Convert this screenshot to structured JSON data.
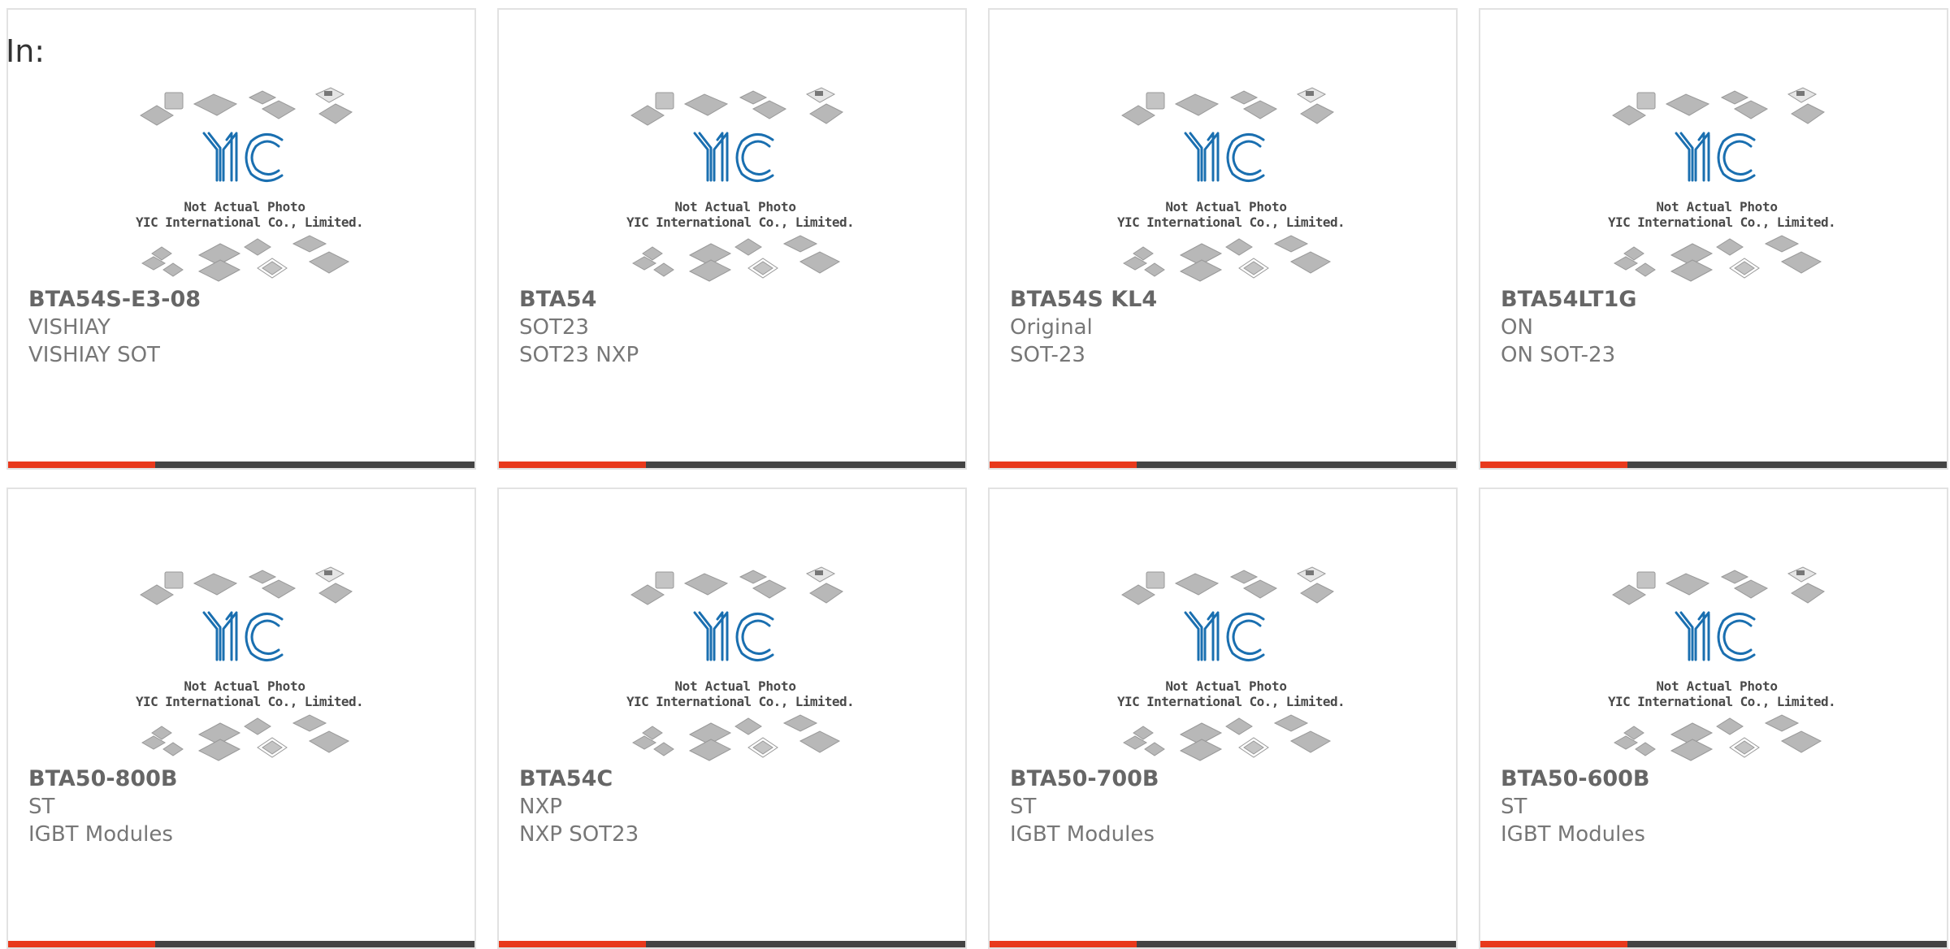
{
  "header": {
    "label": "In:"
  },
  "placeholder": {
    "logo_text": "YIC",
    "line1": "Not Actual Photo",
    "line2": "YIC International Co., Limited."
  },
  "colors": {
    "accent": "#e8391c",
    "bar": "#444444",
    "logo": "#1a6fb0"
  },
  "products": [
    {
      "part": "BTA54S-E3-08",
      "manufacturer": "VISHIAY",
      "description": "VISHIAY SOT"
    },
    {
      "part": "BTA54",
      "manufacturer": "SOT23",
      "description": "SOT23 NXP"
    },
    {
      "part": "BTA54S KL4",
      "manufacturer": "Original",
      "description": "SOT-23"
    },
    {
      "part": "BTA54LT1G",
      "manufacturer": "ON",
      "description": "ON SOT-23"
    },
    {
      "part": "BTA50-800B",
      "manufacturer": "ST",
      "description": "IGBT Modules"
    },
    {
      "part": "BTA54C",
      "manufacturer": "NXP",
      "description": "NXP SOT23"
    },
    {
      "part": "BTA50-700B",
      "manufacturer": "ST",
      "description": "IGBT Modules"
    },
    {
      "part": "BTA50-600B",
      "manufacturer": "ST",
      "description": "IGBT Modules"
    }
  ]
}
